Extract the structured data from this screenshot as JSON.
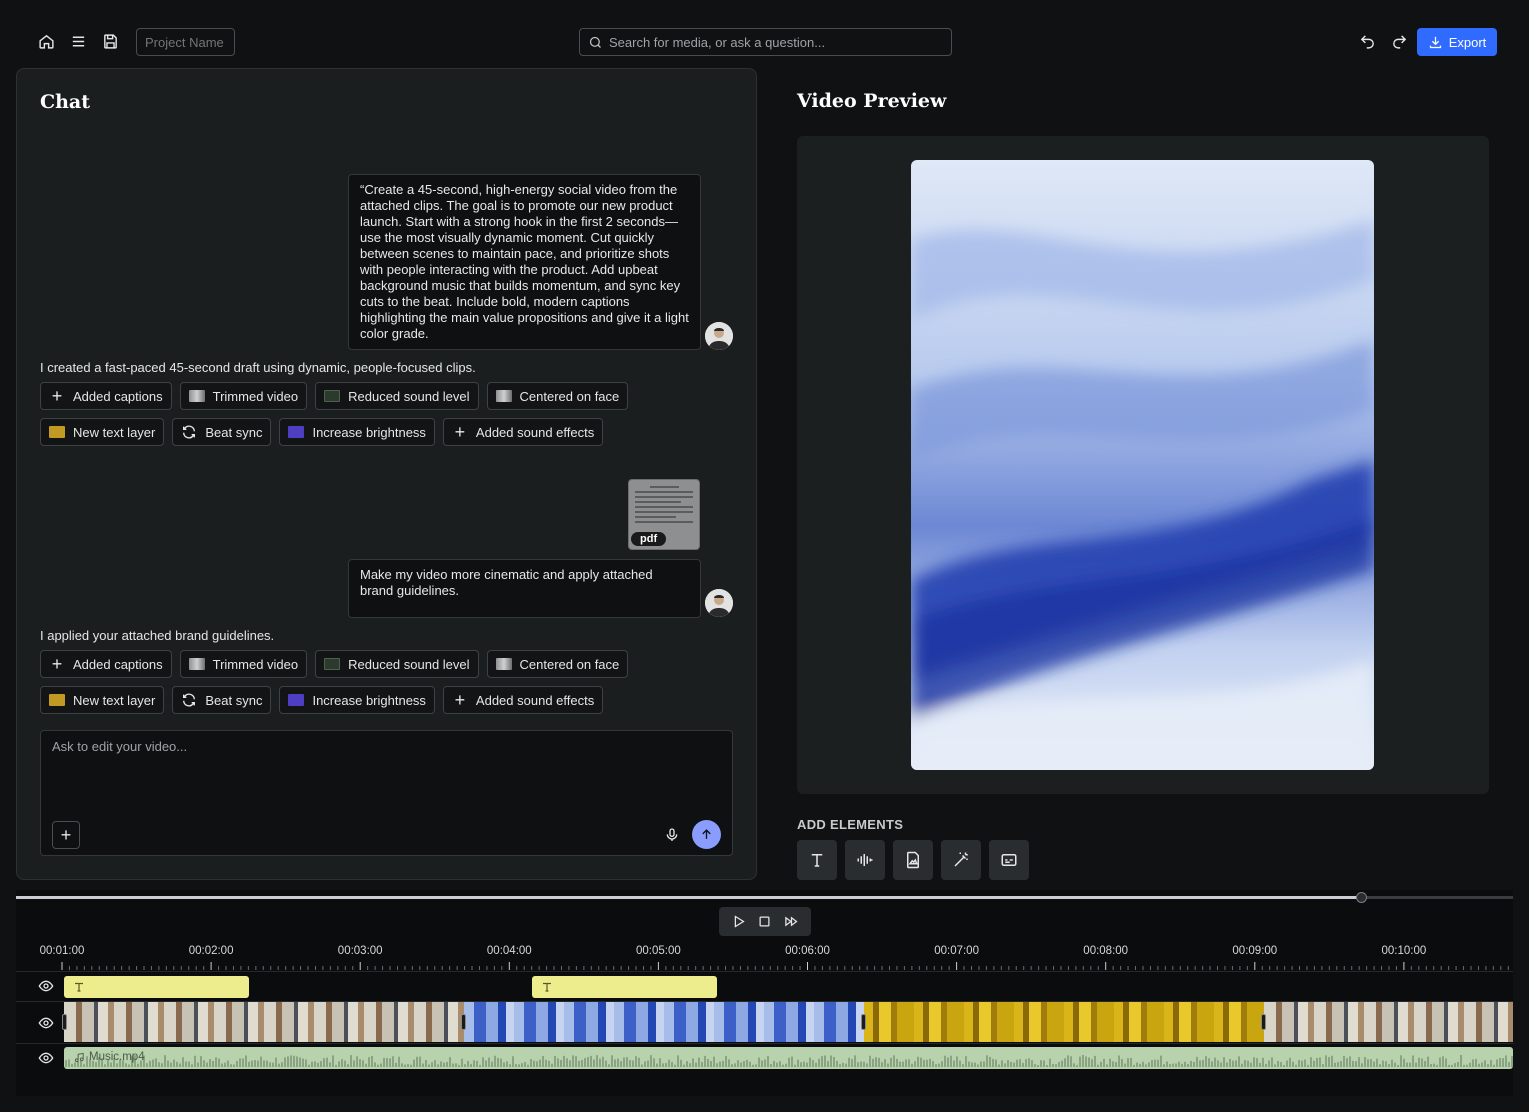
{
  "toolbar": {
    "project_name_placeholder": "Project Name",
    "search_placeholder": "Search for media, or ask a question...",
    "export_label": "Export",
    "accent_color": "#2f6bff"
  },
  "chat": {
    "title": "Chat",
    "messages": [
      {
        "user_text": "“Create a 45-second, high-energy social video from the attached clips. The goal is to promote our new product launch. Start with a strong hook in the first 2 seconds—use the most visually dynamic moment. Cut quickly between scenes to maintain pace, and prioritize shots with people interacting with the product.  Add upbeat background music that builds momentum, and sync key cuts to the beat. Include bold, modern captions highlighting the main value propositions and give it a light color grade.",
        "ai_text": "I created a fast-paced 45-second draft using dynamic, people-focused clips."
      },
      {
        "attachment_label": "pdf",
        "user_text": "Make my video more cinematic and apply attached brand guidelines.",
        "ai_text": "I applied your attached brand guidelines."
      }
    ],
    "chips_row1": [
      "Added captions",
      "Trimmed video",
      "Reduced sound level",
      "Centered on face"
    ],
    "chips_row2": [
      "New text layer",
      "Beat sync",
      "Increase brightness",
      "Added sound effects"
    ],
    "input_placeholder": "Ask to edit your video...",
    "send_color": "#8a9dff"
  },
  "preview": {
    "title": "Video Preview",
    "add_elements_label": "ADD ELEMENTS",
    "element_buttons": [
      "text-icon",
      "audio-wave-icon",
      "image-file-icon",
      "magic-wand-icon",
      "captions-icon"
    ]
  },
  "timeline": {
    "playhead_fraction": 0.899,
    "ticks": [
      "00:01:00",
      "00:02:00",
      "00:03:00",
      "00:04:00",
      "00:05:00",
      "00:06:00",
      "00:07:00",
      "00:08:00",
      "00:09:00",
      "00:10:00"
    ],
    "audio_clip_label": "Music.mp4",
    "text_clip_color": "#eded8e",
    "audio_clip_color": "#b7d2ad"
  }
}
